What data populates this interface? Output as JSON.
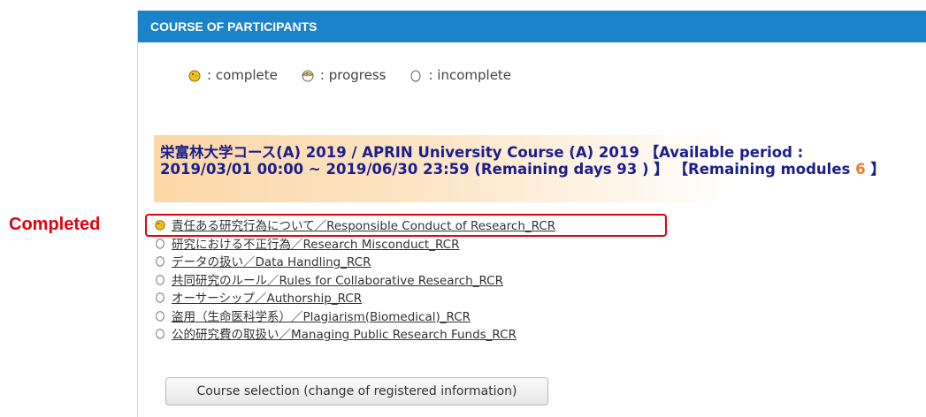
{
  "annotation": "Completed",
  "panel": {
    "title": "COURSE OF PARTICIPANTS"
  },
  "legend": {
    "complete": ": complete",
    "progress": ": progress",
    "incomplete": ": incomplete"
  },
  "course": {
    "title_prefix": "栄富林大学コース(A) 2019 / APRIN University Course (A) 2019 【Available period : 2019/03/01 00:00 ~ 2019/06/30 23:59 (Remaining days 93 ) 】 【Remaining modules ",
    "remaining_modules": "6",
    "title_suffix": " 】"
  },
  "modules": [
    {
      "label": "責任ある研究行為について／Responsible Conduct of Research_RCR",
      "status": "complete"
    },
    {
      "label": "研究における不正行為／Research Misconduct_RCR",
      "status": "incomplete"
    },
    {
      "label": "データの扱い／Data Handling_RCR",
      "status": "incomplete"
    },
    {
      "label": "共同研究のルール／Rules for Collaborative Research_RCR",
      "status": "incomplete"
    },
    {
      "label": "オーサーシップ／Authorship_RCR",
      "status": "incomplete"
    },
    {
      "label": "盗用（生命医科学系）／Plagiarism(Biomedical)_RCR",
      "status": "incomplete"
    },
    {
      "label": "公的研究費の取扱い／Managing Public Research Funds_RCR",
      "status": "incomplete"
    }
  ],
  "button": {
    "label": "Course selection (change of registered information)"
  },
  "colors": {
    "header": "#1b83c7",
    "course_title": "#1b1e8c",
    "remaining_number": "#f07a2a",
    "annotation": "#e60012",
    "chick_yellow": "#f3c31b"
  }
}
